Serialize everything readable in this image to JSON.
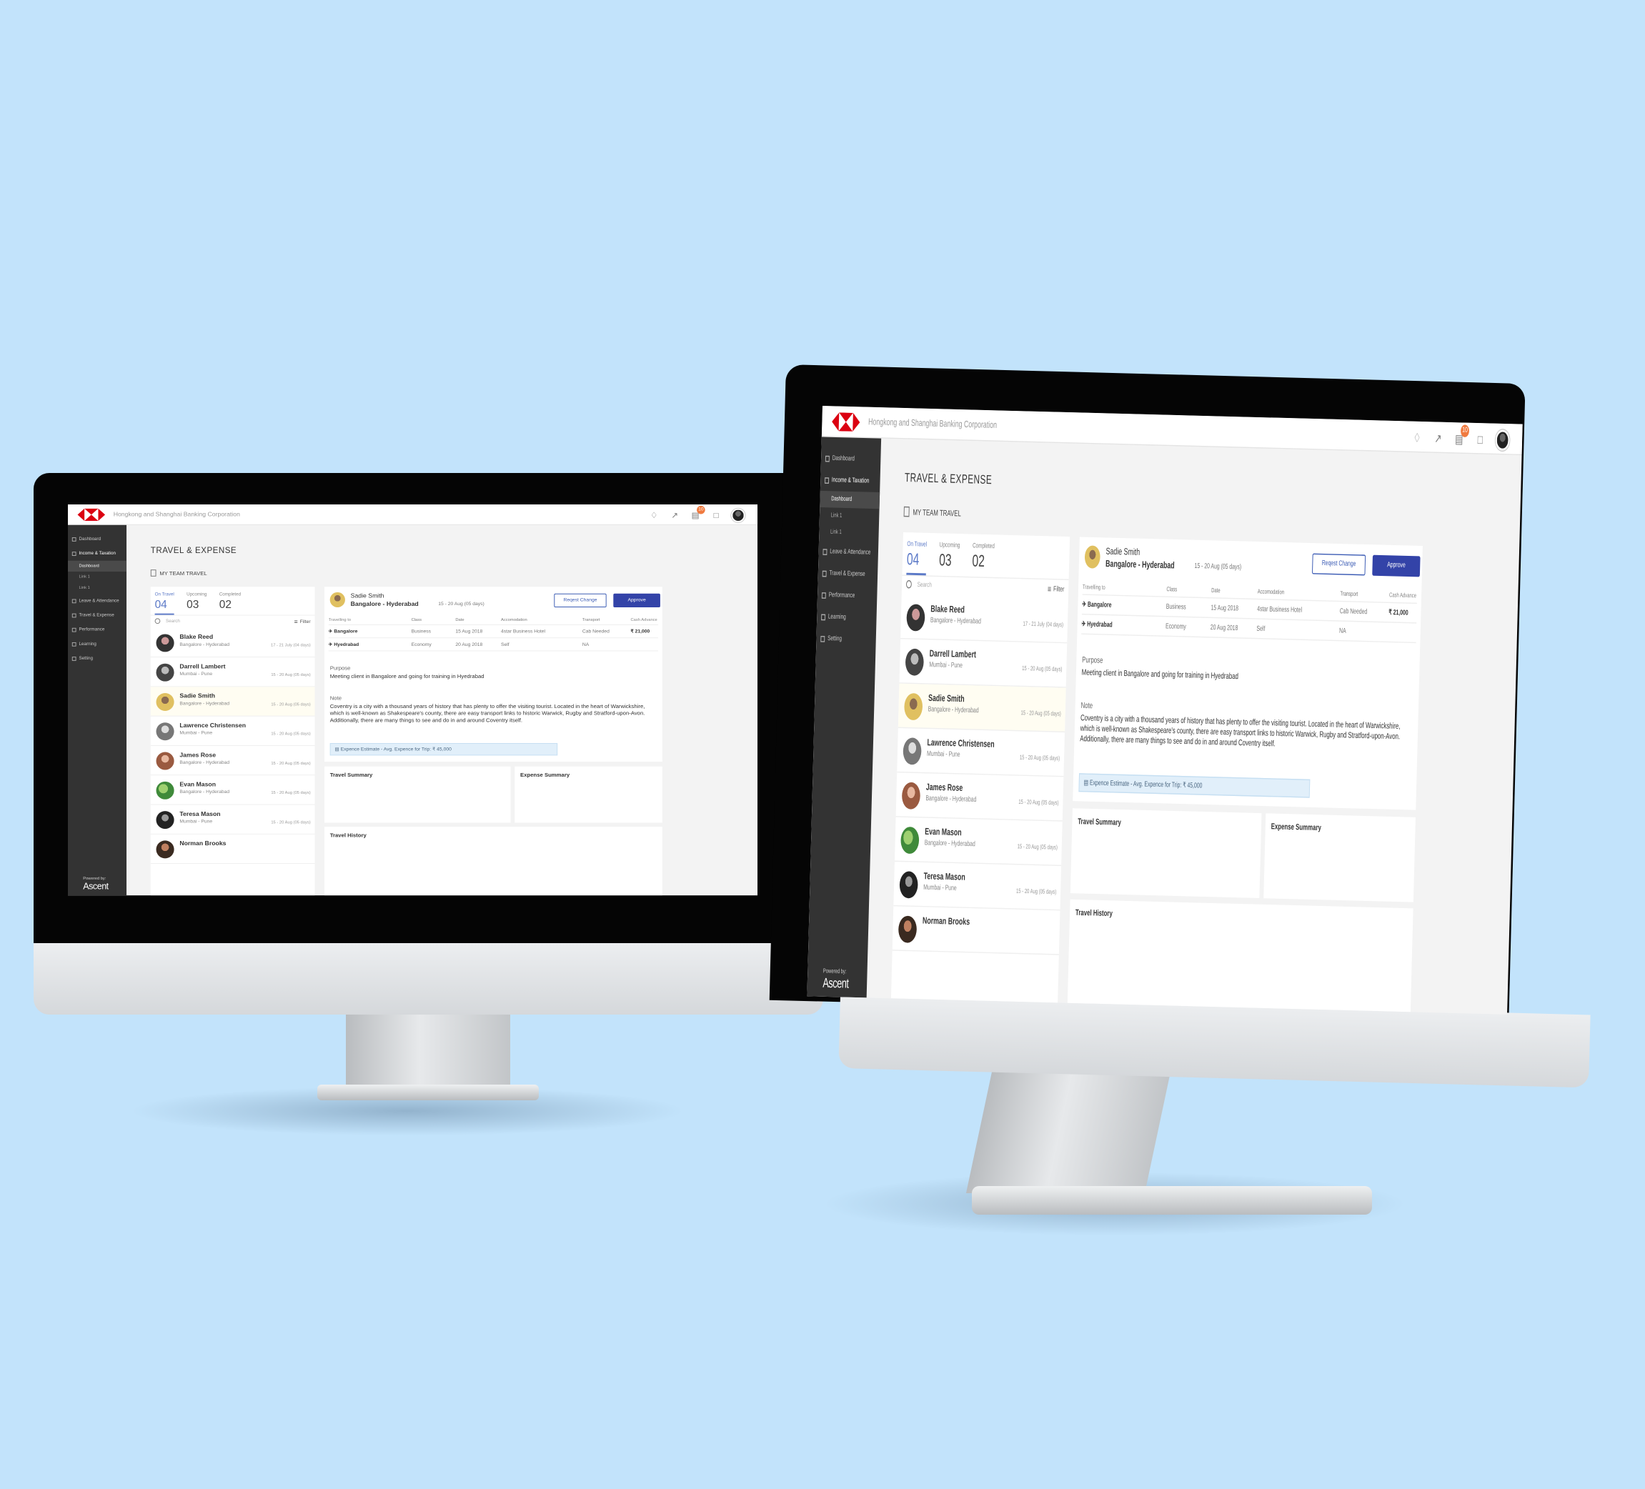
{
  "header": {
    "org_name": "Hongkong and Shanghai Banking Corporation",
    "notification_badge": "10",
    "brand_color": "#db0011"
  },
  "sidebar": {
    "items": [
      {
        "label": "Dashboard"
      },
      {
        "label": "Income & Taxation"
      },
      {
        "label": "Leave & Attendance"
      },
      {
        "label": "Travel & Expense"
      },
      {
        "label": "Performance"
      },
      {
        "label": "Learning"
      },
      {
        "label": "Setting"
      }
    ],
    "sub_items": [
      "Dashboard",
      "Link 1",
      "Link 1"
    ],
    "powered_by": "Powered by:",
    "brand": "Ascent"
  },
  "page": {
    "title": "TRAVEL & EXPENSE",
    "section": "MY TEAM TRAVEL"
  },
  "tabs": [
    {
      "label": "On Travel",
      "count": "04"
    },
    {
      "label": "Upcoming",
      "count": "03"
    },
    {
      "label": "Completed",
      "count": "02"
    }
  ],
  "search": {
    "placeholder": "Search",
    "filter_label": "Filter"
  },
  "employees": [
    {
      "name": "Blake Reed",
      "route": "Bangalore - Hyderabad",
      "dates": "17 - 21 July (04 days)"
    },
    {
      "name": "Darrell Lambert",
      "route": "Mumbai - Pune",
      "dates": "15 - 20 Aug (05 days)"
    },
    {
      "name": "Sadie Smith",
      "route": "Bangalore - Hyderabad",
      "dates": "15 - 20 Aug (05 days)"
    },
    {
      "name": "Lawrence Christensen",
      "route": "Mumbai - Pune",
      "dates": "15 - 20 Aug (05 days)"
    },
    {
      "name": "James Rose",
      "route": "Bangalore - Hyderabad",
      "dates": "15 - 20 Aug (05 days)"
    },
    {
      "name": "Evan Mason",
      "route": "Bangalore - Hyderabad",
      "dates": "15 - 20 Aug (05 days)"
    },
    {
      "name": "Teresa Mason",
      "route": "Mumbai - Pune",
      "dates": "15 - 20 Aug (05 days)"
    },
    {
      "name": "Norman Brooks",
      "route": "",
      "dates": ""
    }
  ],
  "detail": {
    "name": "Sadie Smith",
    "route": "Bangalore - Hyderabad",
    "dates": "15 - 20 Aug (05 days)",
    "request_change": "Reqest Change",
    "approve": "Approve",
    "table_headers": [
      "Travelling to",
      "Class",
      "Date",
      "Accomodation",
      "Transport",
      "Cash Advance"
    ],
    "rows": [
      {
        "city": "Bangalore",
        "class": "Business",
        "date": "15 Aug 2018",
        "accommodation": "4star Business Hotel",
        "transport": "Cab Needed",
        "cash": "₹ 21,000"
      },
      {
        "city": "Hyedrabad",
        "class": "Economy",
        "date": "20 Aug 2018",
        "accommodation": "Self",
        "transport": "NA",
        "cash": ""
      }
    ],
    "purpose_label": "Purpose",
    "purpose": "Meeting client in Bangalore and going for training in Hyedrabad",
    "note_label": "Note",
    "note": "Coventry is a city with a thousand years of history that has plenty to offer the visiting tourist. Located in the heart of Warwickshire, which is well-known as Shakespeare's county, there are easy transport links to historic Warwick, Rugby and Stratford-upon-Avon. Additionally, there are many things to see and do in and around Coventry itself.",
    "estimate": "Expence Estimate - Avg. Expence for Trip: ₹ 45,000"
  },
  "cards": {
    "travel_summary": "Travel Summary",
    "expense_summary": "Expense Summary",
    "travel_history": "Travel History"
  },
  "colors": {
    "accent": "#3343a8",
    "tab_active": "#5b79c7",
    "sidebar": "#333333",
    "badge": "#f07a3f",
    "background": "#c2e3fb"
  }
}
